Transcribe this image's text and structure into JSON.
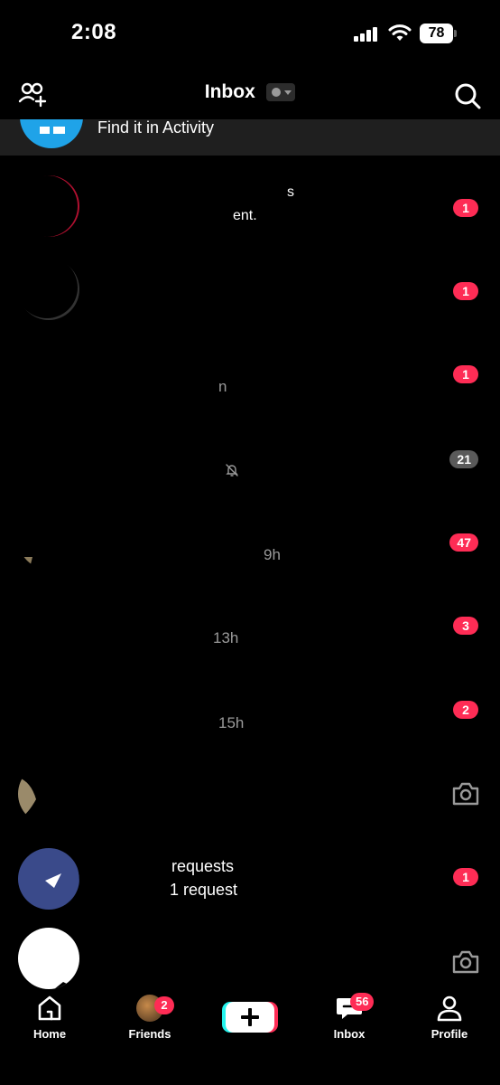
{
  "status_bar": {
    "time": "2:08",
    "battery": "78"
  },
  "header": {
    "title": "Inbox"
  },
  "activity": {
    "text": "Find it in Activity"
  },
  "rows": [
    {
      "line1": "s",
      "line2": "ent.",
      "badge": "1"
    },
    {
      "line1": "",
      "line2": "",
      "badge": "1"
    },
    {
      "line1": "",
      "line2": "n",
      "badge": "1"
    },
    {
      "line1": "",
      "line2": "",
      "badge": "21"
    },
    {
      "line1": "",
      "line2": "9h",
      "badge": "47"
    },
    {
      "line1": "",
      "line2": "13h",
      "badge": "3"
    },
    {
      "line1": "",
      "line2": "15h",
      "badge": "2"
    },
    {
      "line1": "",
      "line2": "",
      "badge": ""
    },
    {
      "line1": "requests",
      "line2": "1 request",
      "badge": "1"
    },
    {
      "line1": "",
      "line2": "",
      "badge": ""
    }
  ],
  "nav": {
    "home": "Home",
    "friends": "Friends",
    "friends_badge": "2",
    "inbox": "Inbox",
    "inbox_badge": "56",
    "profile": "Profile"
  },
  "colors": {
    "accent": "#fe2c55",
    "cyan": "#25f4ee",
    "activity_blue": "#1fa3e8",
    "muted_badge": "#5a5a5a"
  }
}
